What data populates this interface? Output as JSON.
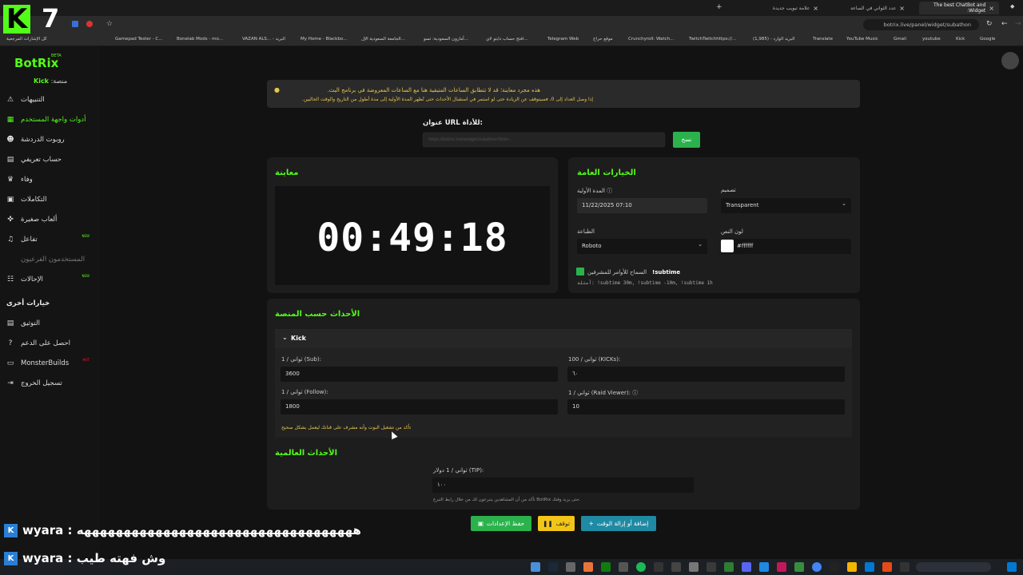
{
  "browser": {
    "tabs": [
      {
        "title": "The best ChatBot and Widget:",
        "active": true
      },
      {
        "title": "عدد الثواني في الساعة",
        "active": false
      },
      {
        "title": "علامة تبويب جديدة",
        "active": false
      }
    ],
    "url": "botrix.live/panel/widget/subathon",
    "bookmarks": [
      "كل الإشارات المرجعية",
      "Gamepad Tester - C...",
      "Bonelab Mods - mo...",
      "VAZAN ALS... - البريد",
      "My Home - Blackbo...",
      "الجامعة السعودية الإل...",
      "أمازون السعودية: تسو...",
      "افتح حساب دايتو لاي...",
      "Telegram Web",
      "موقع حراج",
      "Crunchyroll: Watch...",
      "TwitchTwitchhttps://...",
      "(1,985) - البريد الوارد",
      "Translate",
      "YouTube Music",
      "Gmail",
      "youtube",
      "Kick",
      "Google"
    ]
  },
  "overlay": {
    "k": "K",
    "seven": "7",
    "chat": [
      {
        "user": "wyara",
        "message": "هههههههههههههههههههههههههههههههههههه"
      },
      {
        "user": "wyara",
        "message": "وش فهته طيب"
      }
    ]
  },
  "sidebar": {
    "brand": "BotRix",
    "beta": "BETA",
    "platform_label": "منصة:",
    "platform_value": "Kick",
    "items": [
      {
        "label": "التنبيهات",
        "icon": "warning-icon",
        "glyph": "⚠",
        "state": "normal"
      },
      {
        "label": "أدوات واجهة المستخدم",
        "icon": "widgets-icon",
        "glyph": "▦",
        "state": "active"
      },
      {
        "label": "روبوت الدردشة",
        "icon": "robot-icon",
        "glyph": "☻",
        "state": "normal"
      },
      {
        "label": "حساب تعريفي",
        "icon": "id-card-icon",
        "glyph": "▤",
        "state": "normal"
      },
      {
        "label": "وفاء",
        "icon": "trophy-icon",
        "glyph": "♛",
        "state": "normal"
      },
      {
        "label": "التكاملات",
        "icon": "integration-icon",
        "glyph": "▣",
        "state": "normal"
      },
      {
        "label": "ألعاب صغيرة",
        "icon": "gamepad-icon",
        "glyph": "✜",
        "state": "normal"
      },
      {
        "label": "تفاعل",
        "icon": "music-icon",
        "glyph": "♫",
        "state": "normal",
        "badge": "NEW"
      },
      {
        "label": "المستخدمون الفرعيون",
        "icon": "users-icon",
        "glyph": "",
        "state": "muted"
      },
      {
        "label": "الإحالات",
        "icon": "referral-icon",
        "glyph": "☷",
        "state": "normal",
        "badge": "NEW"
      }
    ],
    "other_title": "خيارات أخرى",
    "other_items": [
      {
        "label": "التوثيق",
        "icon": "docs-icon",
        "glyph": "▤"
      },
      {
        "label": "احصل على الدعم",
        "icon": "help-icon",
        "glyph": "?"
      },
      {
        "label": "MonsterBuilds",
        "icon": "monitor-icon",
        "glyph": "▭",
        "badge": "HOT"
      },
      {
        "label": "تسجيل الخروج",
        "icon": "logout-icon",
        "glyph": "⇥"
      }
    ]
  },
  "warning": {
    "line1": "هذه مجرد معاينة؛ قد لا تتطابق الساعات المتبقية هنا مع الساعات المعروضة في برنامج البث.",
    "line2": "إذا وصل العداد إلى 0، فسيتوقف عن الزيادة حتى لو استمر في استقبال الأحداث حتى تُظهر المدة الأولية إلى مدة أطول من التاريخ والوقت الحاليين."
  },
  "url_section": {
    "label": "عنوان URL للأداة:",
    "value": "https://botrix.live/widget/subathon?bid=...",
    "copy_label": "نسخ"
  },
  "preview": {
    "title": "معاينة",
    "timer": "00:49:18"
  },
  "general": {
    "title": "الخيارات العامة",
    "initial_duration_label": "المدة الأولية",
    "initial_duration_value": "11/22/2025 07:10",
    "design_label": "تصميم",
    "design_value": "Transparent",
    "font_label": "الطباعة",
    "font_value": "Roboto",
    "text_color_label": "لون النص",
    "text_color_value": "#ffffff",
    "allow_label": "السماح للأوامر للمشرفين",
    "command": "!subtime",
    "examples": "أمثلة: !subtime 30m, !subtime -10m, !subtime 1h",
    "allow_enabled": true
  },
  "platform_events": {
    "title": "الأحداث حسب المنصة",
    "platform": "Kick",
    "fields": [
      {
        "label": "1 / ثواني (Sub):",
        "value": "3600"
      },
      {
        "label": "100 / ثواني (KICKs):",
        "value": "٦٠"
      },
      {
        "label": "1 / ثواني (Follow):",
        "value": "1800"
      },
      {
        "label": "1 / ثواني (Raid Viewer):",
        "value": "10"
      }
    ],
    "note": "تأكد من تشغيل البوت وأنه مشرف على قناتك ليعمل بشكل صحيح"
  },
  "global_events": {
    "title": "الأحداث العالمية",
    "tip_label": "ثواني / 1 دولار (TIP):",
    "tip_value": "١٠٠",
    "note": "تأكد من أن المشاهدين يتبرعون لك من خلال رابط التبرع BotRix حتى يزيد وقتك."
  },
  "actions": {
    "save": "حفظ الإعدادات",
    "pause": "توقف",
    "add_remove": "إضافة أو إزالة الوقت"
  },
  "colors": {
    "accent": "#53fc18",
    "save_btn": "#2bb24c",
    "pause_btn": "#f2c519",
    "add_btn": "#1f8aa3",
    "warning_text": "#e8c64a"
  }
}
